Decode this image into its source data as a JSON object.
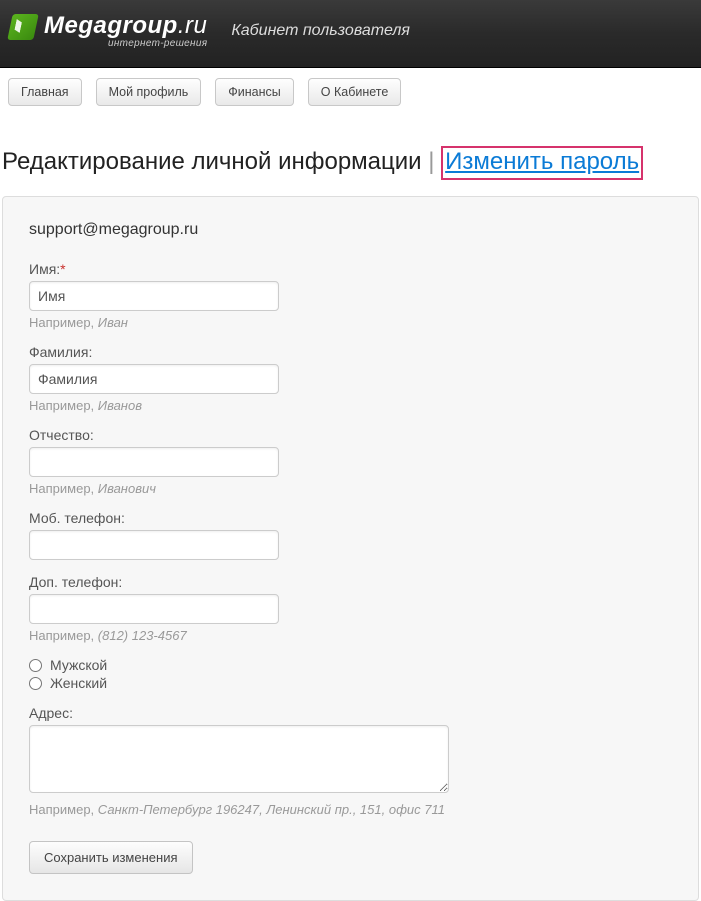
{
  "header": {
    "logo_main": "Megagroup",
    "logo_domain": ".ru",
    "logo_sub": "интернет-решения",
    "title": "Кабинет пользователя"
  },
  "nav": {
    "items": [
      {
        "label": "Главная"
      },
      {
        "label": "Мой профиль"
      },
      {
        "label": "Финансы"
      },
      {
        "label": "О Кабинете"
      }
    ]
  },
  "page": {
    "title_main": "Редактирование личной информации",
    "title_sep": " | ",
    "title_link": "Изменить пароль"
  },
  "form": {
    "account_email": "support@megagroup.ru",
    "fields": {
      "name": {
        "label": "Имя:",
        "required_mark": "*",
        "value": "Имя",
        "hint_prefix": "Например, ",
        "hint_example": "Иван"
      },
      "surname": {
        "label": "Фамилия:",
        "value": "Фамилия",
        "hint_prefix": "Например, ",
        "hint_example": "Иванов"
      },
      "patronymic": {
        "label": "Отчество:",
        "value": "",
        "hint_prefix": "Например, ",
        "hint_example": "Иванович"
      },
      "mobile": {
        "label": "Моб. телефон:",
        "value": ""
      },
      "phone": {
        "label": "Доп. телефон:",
        "value": "",
        "hint_prefix": "Например, ",
        "hint_example": "(812) 123-4567"
      },
      "gender": {
        "male": "Мужской",
        "female": "Женский"
      },
      "address": {
        "label": "Адрес:",
        "value": "",
        "hint_prefix": "Например, ",
        "hint_example": "Санкт-Петербург 196247, Ленинский пр., 151, офис 711"
      }
    },
    "save_label": "Сохранить изменения"
  }
}
